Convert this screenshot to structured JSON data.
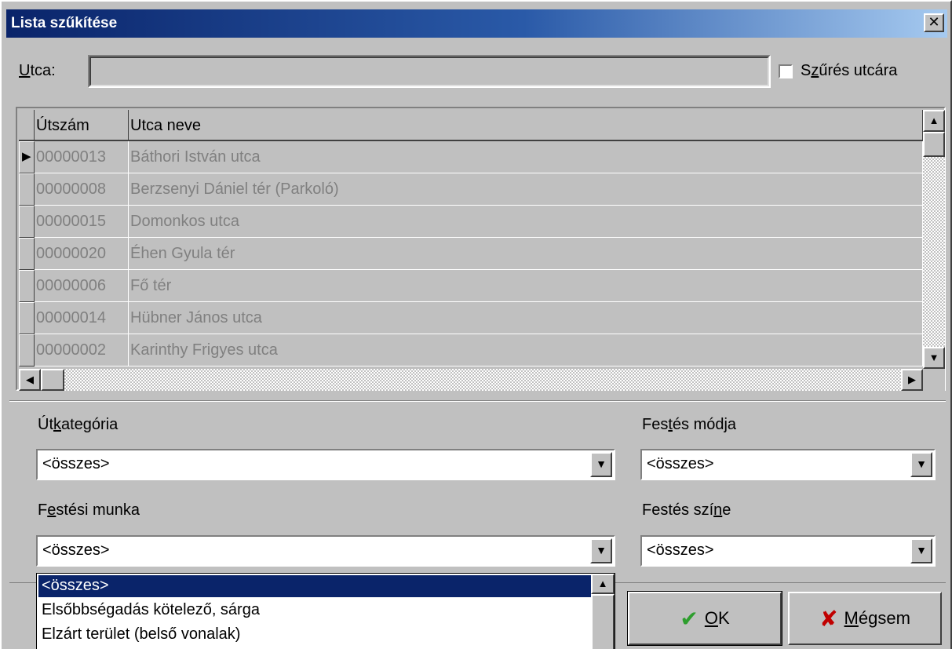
{
  "window": {
    "title": "Lista szűkítése",
    "close_glyph": "✕"
  },
  "street": {
    "label_hotkey": "U",
    "label_rest": "tca:",
    "value": "",
    "filter_label_pre": "S",
    "filter_label_hotkey": "z",
    "filter_label_rest": "űrés utcára",
    "filter_checked": false
  },
  "grid": {
    "columns": [
      "Útszám",
      "Utca neve"
    ],
    "rows": [
      {
        "id": "00000013",
        "name": "Báthori István utca"
      },
      {
        "id": "00000008",
        "name": "Berzsenyi Dániel tér (Parkoló)"
      },
      {
        "id": "00000015",
        "name": "Domonkos utca"
      },
      {
        "id": "00000020",
        "name": "Éhen Gyula tér"
      },
      {
        "id": "00000006",
        "name": "Fő tér"
      },
      {
        "id": "00000014",
        "name": "Hübner János utca"
      },
      {
        "id": "00000002",
        "name": "Karinthy Frigyes utca"
      }
    ],
    "selected_row_index": 0
  },
  "filters": {
    "road_category": {
      "label_pre": "Út",
      "label_hotkey": "k",
      "label_rest": "ategória",
      "value": "<összes>"
    },
    "paint_mode": {
      "label_pre": "Fes",
      "label_hotkey": "t",
      "label_rest": "és módja",
      "value": "<összes>"
    },
    "paint_work": {
      "label_pre": "F",
      "label_hotkey": "e",
      "label_rest": "stési munka",
      "value": "<összes>"
    },
    "paint_color": {
      "label_pre": "Festés szí",
      "label_hotkey": "n",
      "label_rest": "e",
      "value": "<összes>"
    }
  },
  "dropdown": {
    "items": [
      "<összes>",
      "Elsőbbségadás kötelező, sárga",
      "Elzárt terület (belső vonalak)"
    ],
    "selected_index": 0
  },
  "buttons": {
    "ok": {
      "hotkey": "O",
      "rest": "K",
      "icon_color": "#2e9e2e"
    },
    "cancel": {
      "hotkey": "M",
      "rest": "égsem",
      "icon_color": "#c00000"
    }
  },
  "colors": {
    "title_start": "#0a246a",
    "title_end": "#a6caf0",
    "selection": "#0a246a"
  }
}
